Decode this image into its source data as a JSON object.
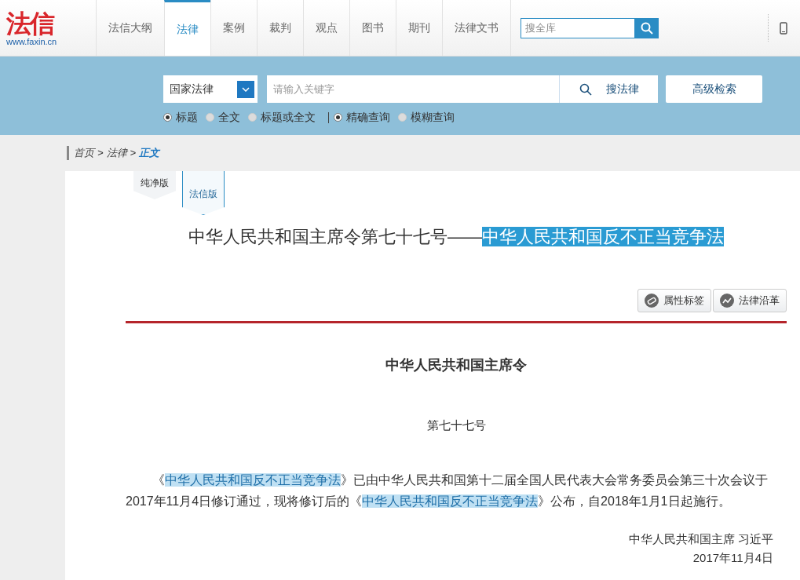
{
  "logo": {
    "title": "法信",
    "url": "www.faxin.cn"
  },
  "nav": [
    {
      "label": "法信大纲",
      "selected": false
    },
    {
      "label": "法律",
      "selected": true
    },
    {
      "label": "案例",
      "selected": false
    },
    {
      "label": "裁判",
      "selected": false
    },
    {
      "label": "观点",
      "selected": false
    },
    {
      "label": "图书",
      "selected": false
    },
    {
      "label": "期刊",
      "selected": false
    },
    {
      "label": "法律文书",
      "selected": false
    }
  ],
  "global_search": {
    "placeholder": "搜全库"
  },
  "search": {
    "category": "国家法律",
    "placeholder": "请输入关键字",
    "button": "搜法律",
    "advanced": "高级检索"
  },
  "radio_groups": [
    [
      {
        "label": "标题",
        "selected": true
      },
      {
        "label": "全文",
        "selected": false
      },
      {
        "label": "标题或全文",
        "selected": false
      }
    ],
    [
      {
        "label": "精确查询",
        "selected": true
      },
      {
        "label": "模糊查询",
        "selected": false
      }
    ]
  ],
  "breadcrumb": [
    {
      "label": "首页",
      "current": false
    },
    {
      "label": ">",
      "kind": "sep"
    },
    {
      "label": "法律",
      "current": false
    },
    {
      "label": ">",
      "kind": "sep"
    },
    {
      "label": "正文",
      "current": true
    }
  ],
  "versions": [
    {
      "label": "纯净版",
      "selected": false
    },
    {
      "label": "法信版",
      "selected": true
    }
  ],
  "title": [
    {
      "text": "中华人民共和国主席令第七十七号——",
      "highlight": false
    },
    {
      "text": "中华人民共和国反不正当竞争法",
      "highlight": true
    }
  ],
  "tools": [
    {
      "label": "属性标签",
      "kind": "tag"
    },
    {
      "label": "法律沿革",
      "kind": "trend"
    }
  ],
  "document": {
    "heading": "中华人民共和国主席令",
    "number": "第七十七号",
    "paragraph": [
      {
        "text": "《",
        "highlight": false
      },
      {
        "text": "中华人民共和国反不正当竞争法",
        "highlight": true
      },
      {
        "text": "》已由中华人民共和国第十二届全国人民代表大会常务委员会第三十次会议于2017年11月4日修订通过，现将修订后的《",
        "highlight": false
      },
      {
        "text": "中华人民共和国反不正当竞争法",
        "highlight": true
      },
      {
        "text": "》公布，自2018年1月1日起施行。",
        "highlight": false
      }
    ],
    "signer": "中华人民共和国主席 习近平",
    "date": "2017年11月4日"
  }
}
